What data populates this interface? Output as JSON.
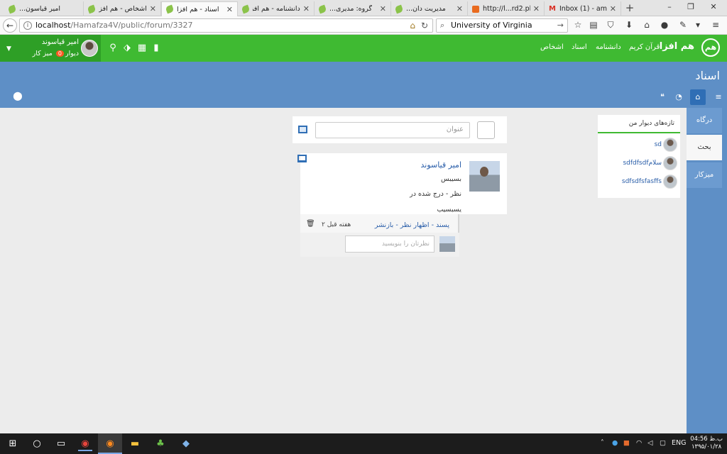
{
  "browser": {
    "tabs": [
      {
        "title": "امیر قیاسون...",
        "favicon": "leaf-icon",
        "active": false
      },
      {
        "title": "اشخاص - هم افزا",
        "favicon": "leaf-icon",
        "active": false
      },
      {
        "title": "اسناد - هم افزا",
        "favicon": "leaf-icon",
        "active": true
      },
      {
        "title": "دانشنامه - هم افزا",
        "favicon": "leaf-icon",
        "active": false
      },
      {
        "title": "گروه: مدیری...",
        "favicon": "leaf-icon",
        "active": false
      },
      {
        "title": "مدیریت دان...",
        "favicon": "leaf-icon",
        "active": false
      },
      {
        "title": "http://l...rd2.php",
        "favicon": "xml-icon",
        "active": false
      },
      {
        "title": "Inbox (1) - am...",
        "favicon": "gmail-icon",
        "active": false
      }
    ],
    "close_glyph": "✕",
    "new_tab": "+",
    "window_controls": [
      "–",
      "❐",
      "✕"
    ],
    "url_host": "localhost",
    "url_path": "/Hamafza4V/public/forum/3327",
    "search_value": "University of Virginia"
  },
  "header": {
    "brand": "هم افزا",
    "logo_text": "هم",
    "nav": [
      "قرآن کریم",
      "دانشنامه",
      "اسناد",
      "اشخاص"
    ],
    "user_name": "امیر قیاسوند",
    "user_desk_prefix": "دیوار",
    "user_desk_badge": "0",
    "user_desk_suffix": "میز کار",
    "icons": [
      "search-icon",
      "tag-icon",
      "grid-icon",
      "bookmark-icon"
    ]
  },
  "banner": {
    "title": "اسناد"
  },
  "sidebar": {
    "items": [
      {
        "label": "درگاه",
        "active": false
      },
      {
        "label": "بحث",
        "active": true
      },
      {
        "label": "میزکار",
        "active": false
      }
    ]
  },
  "wall": {
    "title": "تازه‌های دیوار من",
    "items": [
      "sd",
      "sdfdfsdfسلام",
      "sdfsdfsfasffs"
    ]
  },
  "new_post": {
    "placeholder": "عنوان"
  },
  "post": {
    "author": "امیر قیاسوند",
    "lines": [
      "بسیبس",
      "نظر - درج شده در",
      "یسبسیب"
    ],
    "actions": "پسند - اظهار نظر - بازنشر",
    "time": "۲ هفته قبل",
    "comment_placeholder": "نظرتان را بنویسید"
  },
  "taskbar": {
    "lang": "ENG",
    "time": "04:56 ب.ظ",
    "date": "۱۳۹۵/۰۱/۲۸"
  },
  "colors": {
    "green_header": "#3fba32",
    "blue_banner": "#5e8fc6",
    "link": "#2a5ea9"
  }
}
